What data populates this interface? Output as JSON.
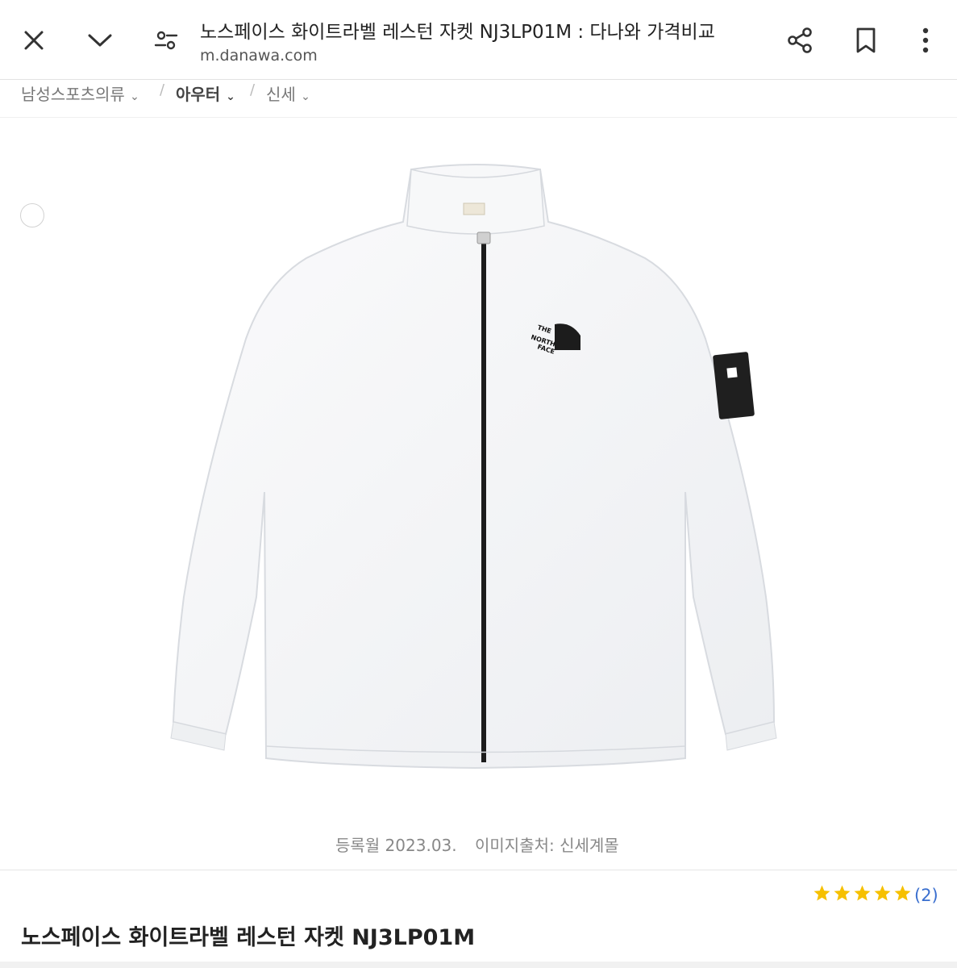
{
  "browser": {
    "title": "노스페이스 화이트라벨 레스턴 자켓 NJ3LP01M : 다나와 가격비교",
    "url": "m.danawa.com",
    "icons": [
      "close-icon",
      "chevron-down-icon",
      "tune-icon",
      "share-icon",
      "bookmark-icon",
      "more-vert-icon"
    ]
  },
  "breadcrumb": [
    {
      "label": "남성스포츠의류"
    },
    {
      "label": "아우터"
    },
    {
      "label": "신세"
    }
  ],
  "product": {
    "registered": "등록월 2023.03.",
    "image_source": "이미지출처: 신세계몰",
    "name": "노스페이스 화이트라벨 레스턴 자켓 NJ3LP01M",
    "rating_stars": 5,
    "review_count": "(2)",
    "logo_text": "THE NORTH FACE"
  },
  "colors": {
    "star": "#f6c000",
    "link": "#3a6fcf",
    "jacket": "#f4f5f7",
    "zipper": "#1c1c1c"
  }
}
